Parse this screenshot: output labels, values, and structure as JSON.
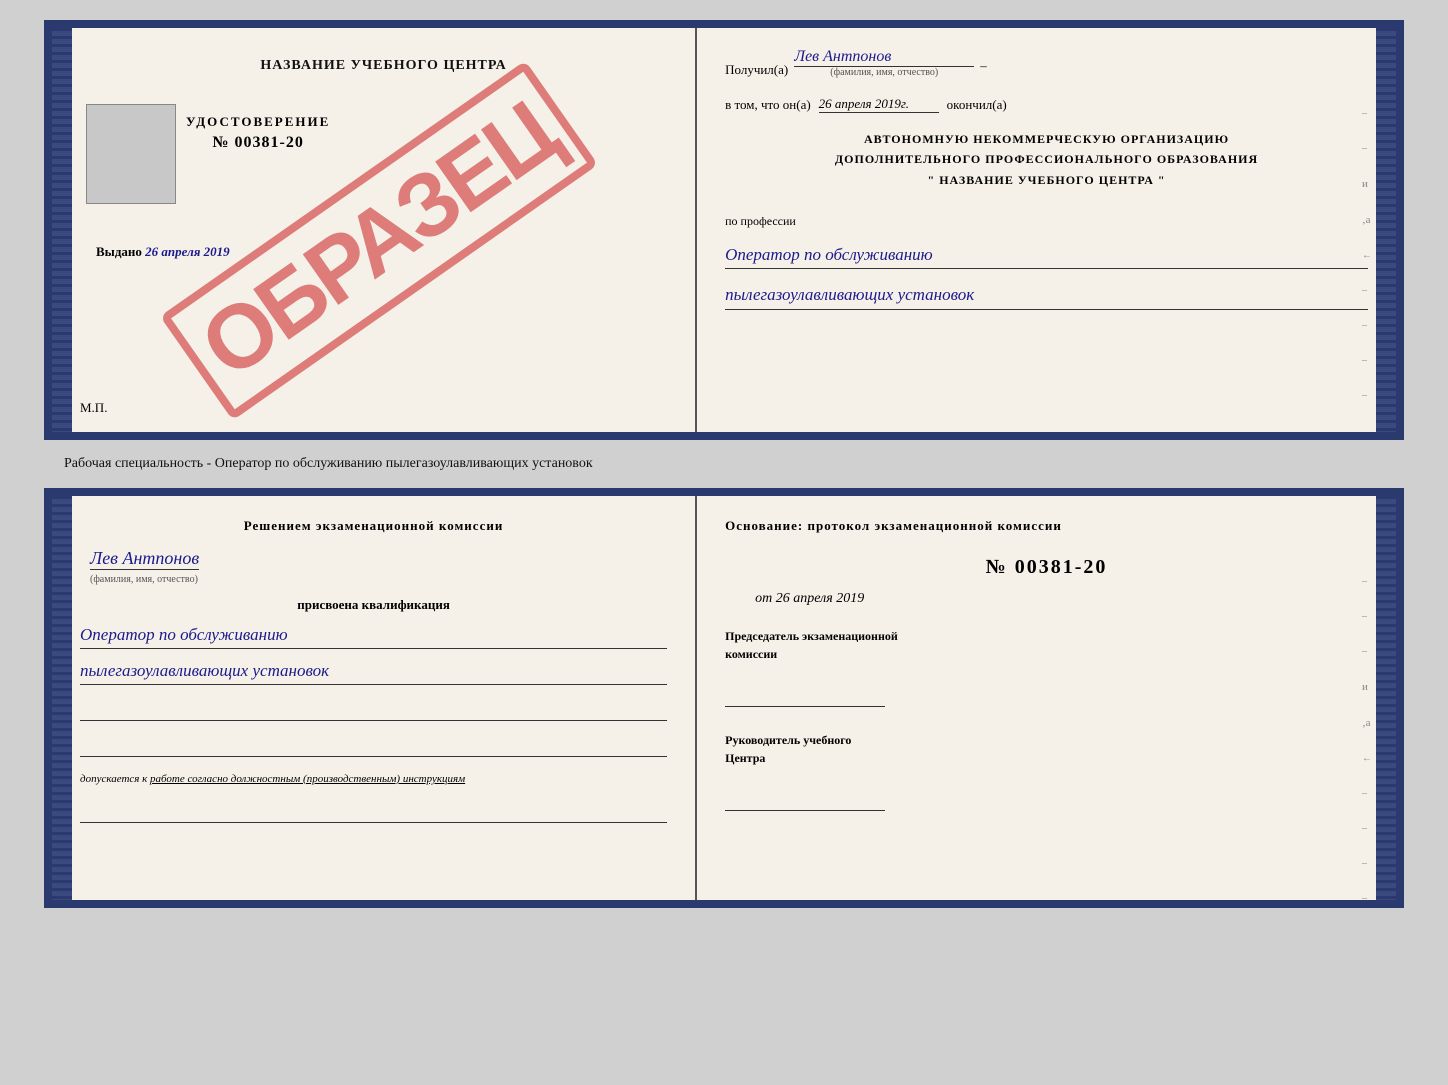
{
  "top_section": {
    "left": {
      "title": "НАЗВАНИЕ УЧЕБНОГО ЦЕНТРА",
      "stamp": "ОБРАЗЕЦ",
      "cert_label": "УДОСТОВЕРЕНИЕ",
      "cert_number": "№ 00381-20",
      "issued_label": "Выдано",
      "issued_date": "26 апреля 2019",
      "mp": "М.П."
    },
    "right": {
      "received_prefix": "Получил(а)",
      "received_name": "Лев Антпонов",
      "fio_label": "(фамилия, имя, отчество)",
      "in_that_prefix": "в том, что он(а)",
      "date_value": "26 апреля 2019г.",
      "finished": "окончил(а)",
      "org_line1": "АВТОНОМНУЮ НЕКОММЕРЧЕСКУЮ ОРГАНИЗАЦИЮ",
      "org_line2": "ДОПОЛНИТЕЛЬНОГО ПРОФЕССИОНАЛЬНОГО ОБРАЗОВАНИЯ",
      "org_quote_open": "\"",
      "org_name": "НАЗВАНИЕ УЧЕБНОГО ЦЕНТРА",
      "org_quote_close": "\"",
      "profession_label": "по профессии",
      "profession_line1": "Оператор по обслуживанию",
      "profession_line2": "пылегазоулавливающих установок"
    }
  },
  "between_text": "Рабочая специальность - Оператор по обслуживанию пылегазоулавливающих установок",
  "bottom_section": {
    "left": {
      "decision_text1": "Решением экзаменационной комиссии",
      "person_name": "Лев Антпонов",
      "fio_label": "(фамилия, имя, отчество)",
      "assigned_label": "присвоена квалификация",
      "qualification_line1": "Оператор по обслуживанию",
      "qualification_line2": "пылегазоулавливающих установок",
      "admission_prefix": "допускается к",
      "admission_text": "работе согласно должностным (производственным) инструкциям"
    },
    "right": {
      "osnov_text": "Основание: протокол экзаменационной комиссии",
      "proto_number": "№ 00381-20",
      "date_prefix": "от",
      "date_value": "26 апреля 2019",
      "chairman_label1": "Председатель экзаменационной",
      "chairman_label2": "комиссии",
      "head_label1": "Руководитель учебного",
      "head_label2": "Центра"
    }
  }
}
